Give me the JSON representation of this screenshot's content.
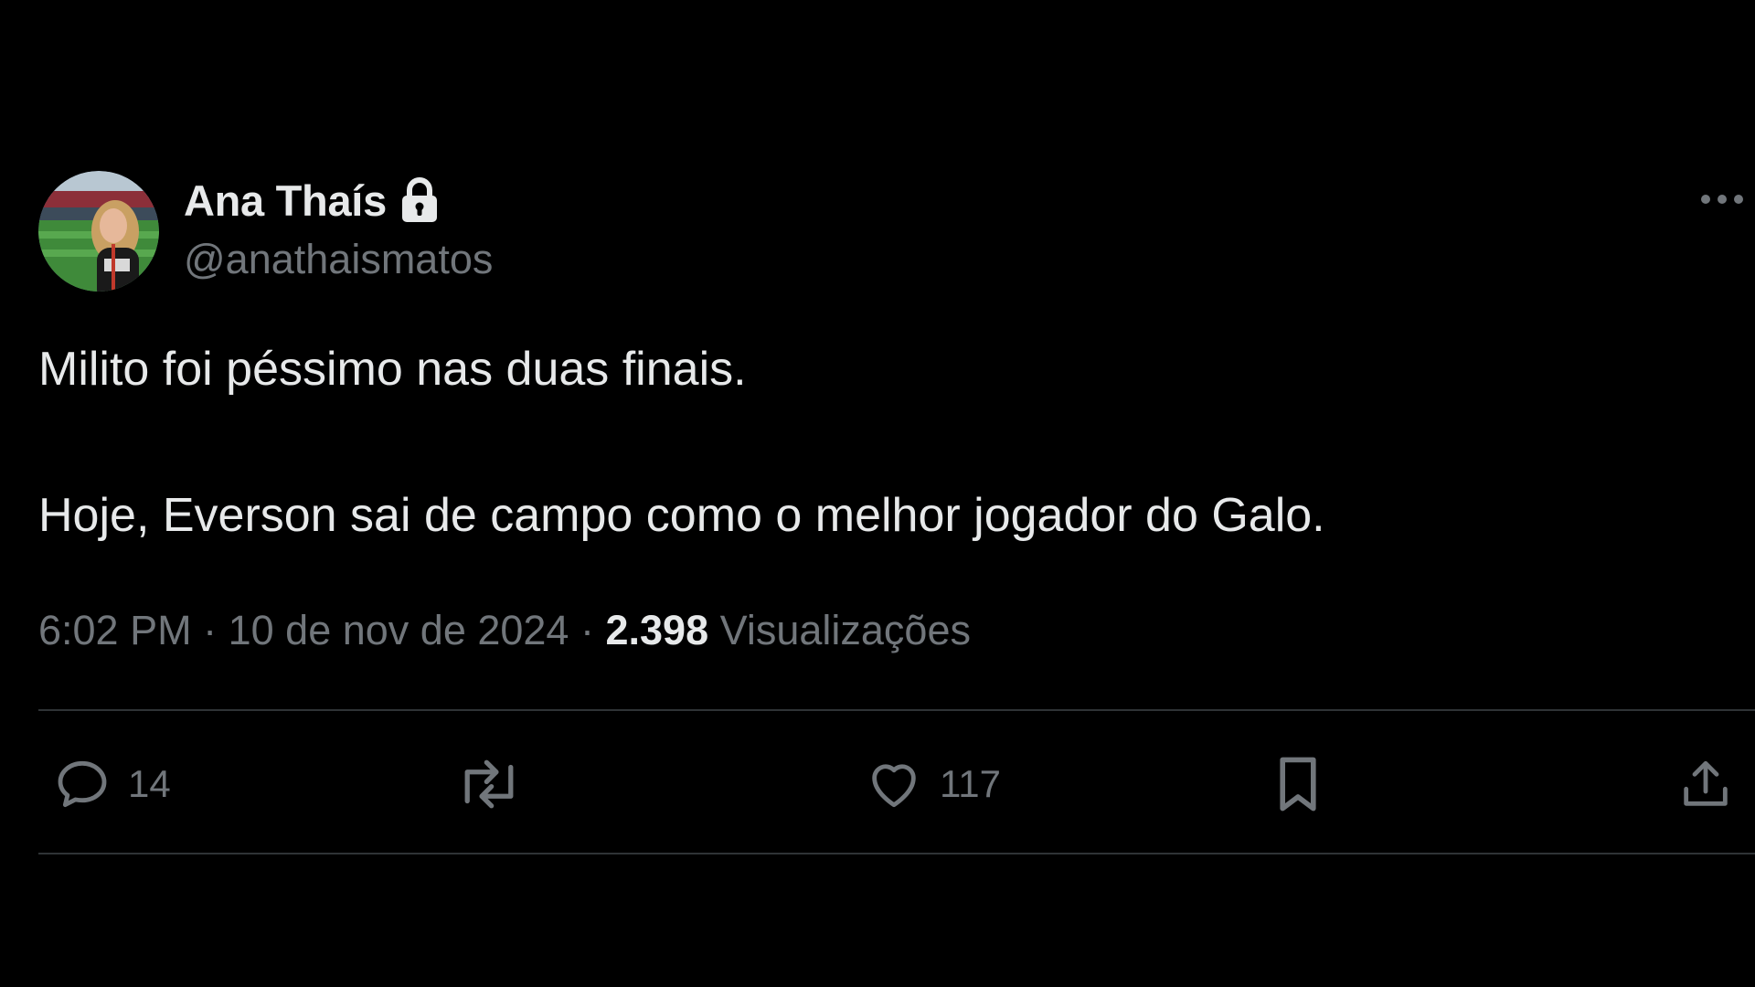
{
  "tweet": {
    "author": {
      "display_name": "Ana Thaís",
      "handle": "@anathaismatos",
      "protected_icon": "lock-icon"
    },
    "text_lines": [
      "Milito foi péssimo nas duas finais.",
      "Hoje, Everson sai de campo como o melhor jogador do Galo."
    ],
    "meta": {
      "time": "6:02 PM",
      "separator": "·",
      "date": "10 de nov de 2024",
      "views_count": "2.398",
      "views_label": "Visualizações"
    },
    "actions": {
      "reply": {
        "icon": "reply-icon",
        "count": "14"
      },
      "repost": {
        "icon": "repost-icon"
      },
      "like": {
        "icon": "heart-icon",
        "count": "117"
      },
      "bookmark": {
        "icon": "bookmark-icon"
      },
      "share": {
        "icon": "share-icon"
      }
    },
    "more_icon": "more-icon"
  },
  "colors": {
    "background": "#000000",
    "primary_text": "#e7e9ea",
    "secondary_text": "#71767b",
    "divider": "#2f3336"
  }
}
